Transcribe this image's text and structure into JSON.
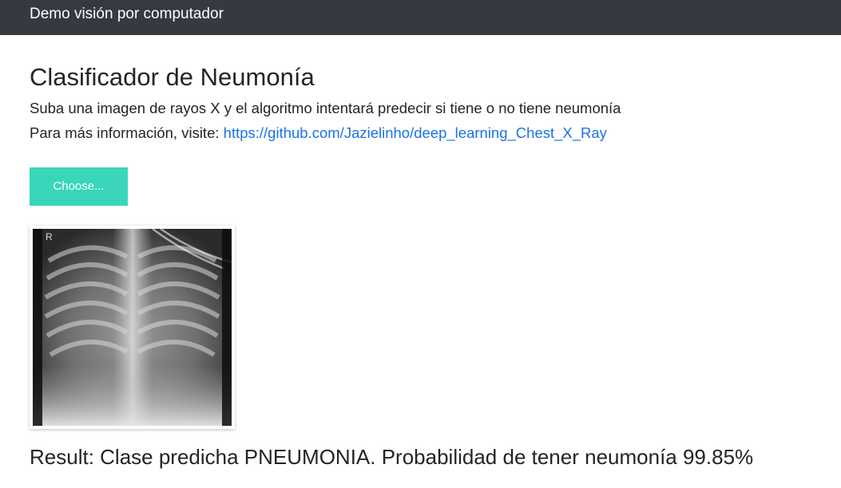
{
  "navbar": {
    "brand": "Demo visión por computador"
  },
  "page": {
    "title": "Clasificador de Neumonía",
    "subtitle": "Suba una imagen de rayos X y el algoritmo intentará predecir si tiene o no tiene neumonía",
    "info_prefix": "Para más información, visite: ",
    "info_link": "https://github.com/Jazielinho/deep_learning_Chest_X_Ray"
  },
  "upload": {
    "choose_label": "Choose..."
  },
  "image": {
    "marker": "R"
  },
  "result": {
    "text": "Result: Clase predicha PNEUMONIA. Probabilidad de tener neumonía 99.85%"
  },
  "colors": {
    "navbar_bg": "#343a40",
    "button_bg": "#3ad6b9",
    "link": "#1a73e8"
  }
}
